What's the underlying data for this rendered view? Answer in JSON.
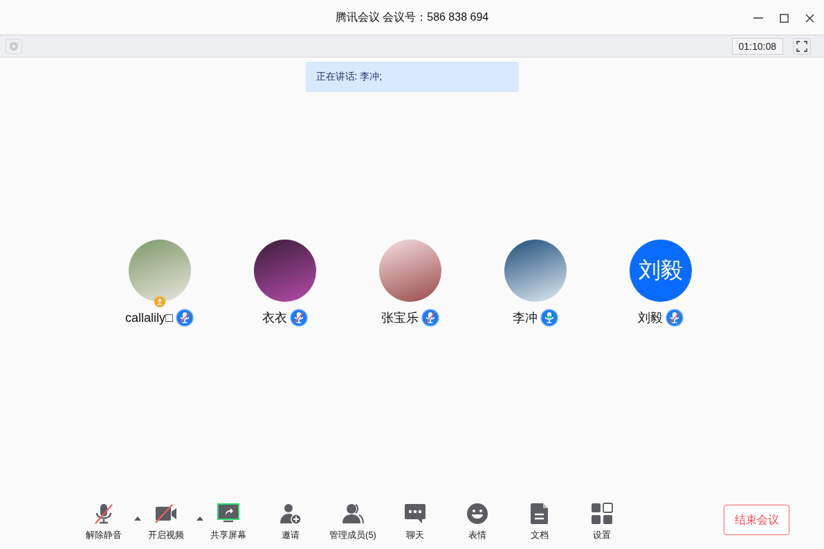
{
  "window": {
    "title": "腾讯会议 会议号：586 838 694"
  },
  "top_bar": {
    "timer": "01:10:08"
  },
  "speaking_banner": "正在讲话: 李冲;",
  "participants": [
    {
      "name": "callalily□",
      "kind": "photo",
      "host": true,
      "muted": true
    },
    {
      "name": "衣衣",
      "kind": "photo",
      "host": false,
      "muted": true
    },
    {
      "name": "张宝乐",
      "kind": "photo",
      "host": false,
      "muted": true
    },
    {
      "name": "李冲",
      "kind": "photo",
      "host": false,
      "muted": false
    },
    {
      "name": "刘毅",
      "kind": "initials",
      "initials": "刘毅",
      "host": false,
      "muted": true
    }
  ],
  "toolbar": [
    {
      "kind": "mic",
      "label": "解除静音",
      "has_menu": true
    },
    {
      "kind": "video",
      "label": "开启视频",
      "has_menu": true
    },
    {
      "kind": "share",
      "label": "共享屏幕",
      "has_menu": false
    },
    {
      "kind": "invite",
      "label": "邀请",
      "has_menu": false
    },
    {
      "kind": "members",
      "label": "管理成员(5)",
      "has_menu": false
    },
    {
      "kind": "chat",
      "label": "聊天",
      "has_menu": false
    },
    {
      "kind": "emoji",
      "label": "表情",
      "has_menu": false
    },
    {
      "kind": "doc",
      "label": "文档",
      "has_menu": false
    },
    {
      "kind": "settings",
      "label": "设置",
      "has_menu": false
    }
  ],
  "end_button": "结束会议"
}
